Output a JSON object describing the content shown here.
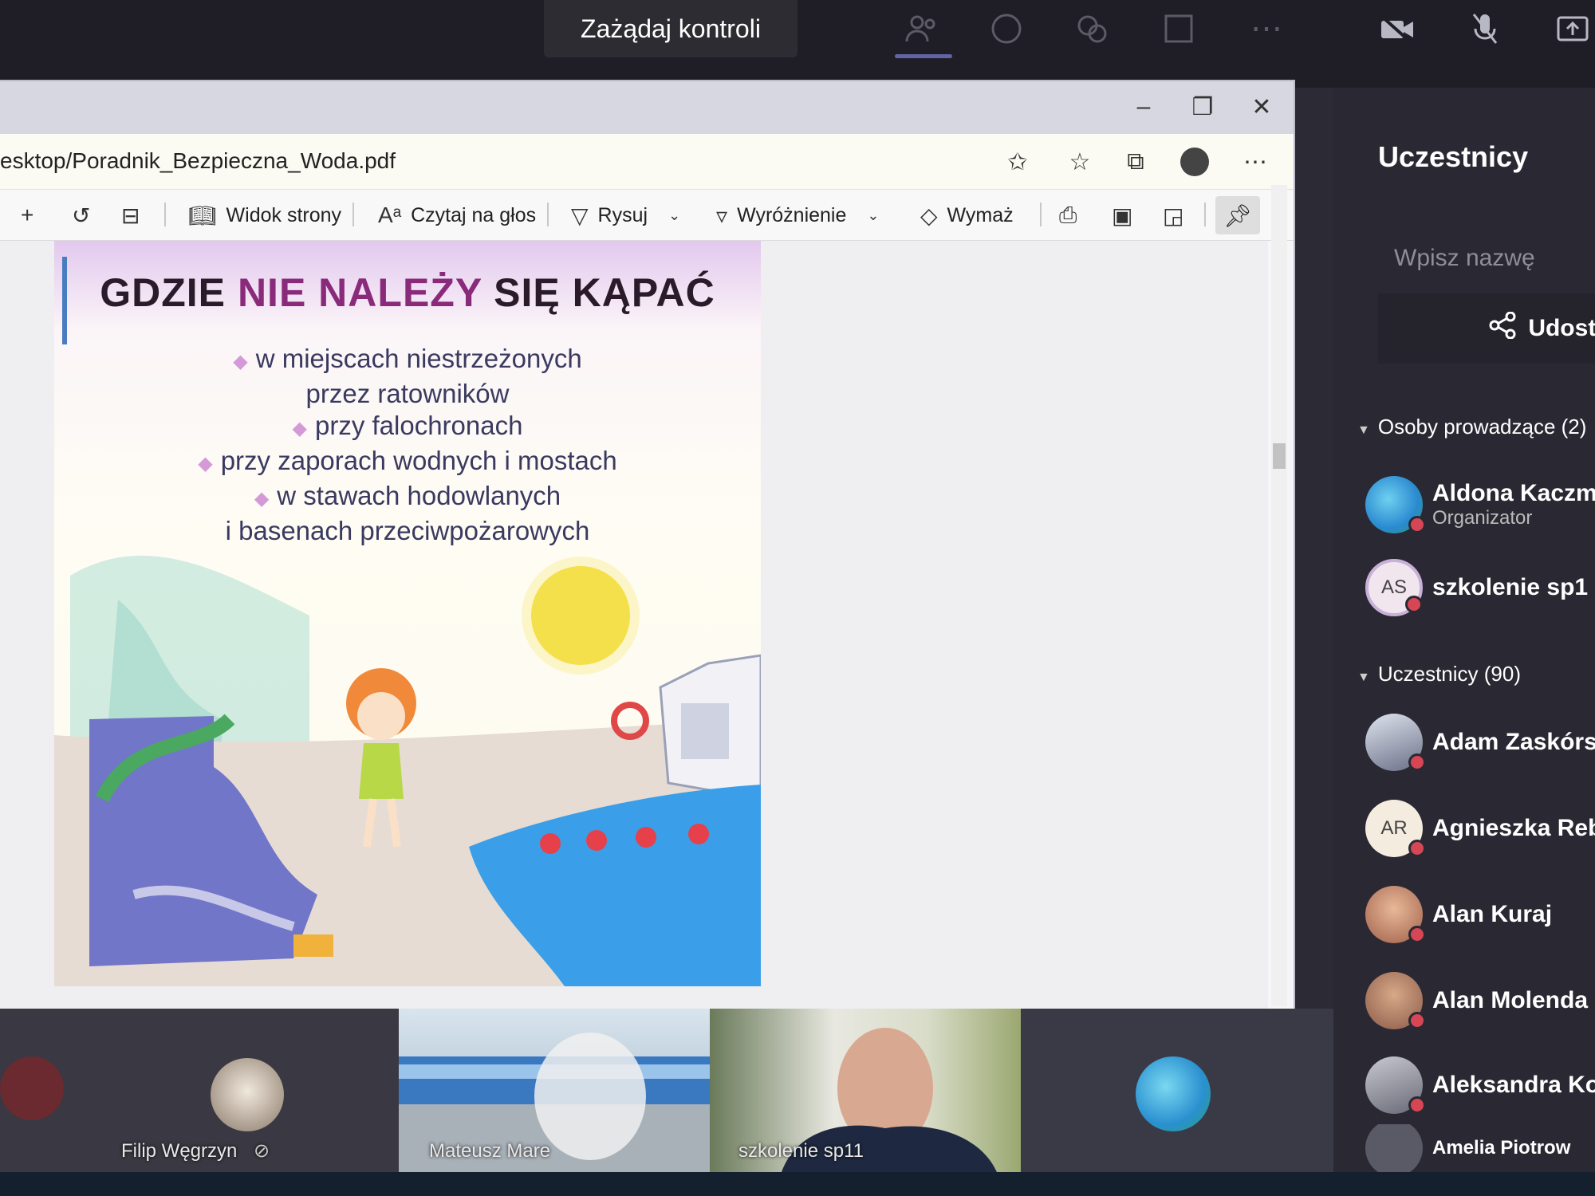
{
  "teams": {
    "control_button": "Zażądaj kontroli",
    "top_icons": [
      "participants-icon",
      "chat-icon",
      "reactions-icon",
      "rooms-icon",
      "more-icon",
      "camera-off-icon",
      "mic-off-icon",
      "share-icon"
    ]
  },
  "browser": {
    "url": "esktop/Poradnik_Bezpieczna_Woda.pdf",
    "toolbar": {
      "page_view": "Widok strony",
      "read_aloud": "Czytaj na głos",
      "draw": "Rysuj",
      "highlight": "Wyróżnienie",
      "erase": "Wymaż"
    }
  },
  "pdf_page": {
    "title_part1": "GDZIE ",
    "title_part2": "NIE NALEŻY",
    "title_part3": " SIĘ KĄPAĆ",
    "bullets": [
      "w miejscach niestrzeżonych",
      "przez ratowników",
      "przy falochronach",
      "przy zaporach wodnych i mostach",
      "w stawach hodowlanych",
      "i basenach przeciwpożarowych"
    ]
  },
  "participants_panel": {
    "title": "Uczestnicy",
    "search_placeholder": "Wpisz nazwę",
    "share_label": "Udostę",
    "presenters_header": "Osoby prowadzące (2)",
    "presenters": [
      {
        "name": "Aldona Kaczm",
        "role": "Organizator",
        "initials": ""
      },
      {
        "name": "szkolenie sp1",
        "role": "",
        "initials": "AS"
      }
    ],
    "attendees_header": "Uczestnicy (90)",
    "attendees": [
      {
        "name": "Adam Zaskórs",
        "initials": ""
      },
      {
        "name": "Agnieszka Reb",
        "initials": "AR"
      },
      {
        "name": "Alan Kuraj",
        "initials": ""
      },
      {
        "name": "Alan Molenda",
        "initials": ""
      },
      {
        "name": "Aleksandra Ko",
        "initials": ""
      },
      {
        "name": "Amelia Piotrow",
        "initials": ""
      }
    ]
  },
  "video_strip": {
    "tiles": [
      {
        "name": "Filip Węgrzyn"
      },
      {
        "name": "Mateusz Mare"
      },
      {
        "name": "szkolenie sp11"
      }
    ]
  }
}
